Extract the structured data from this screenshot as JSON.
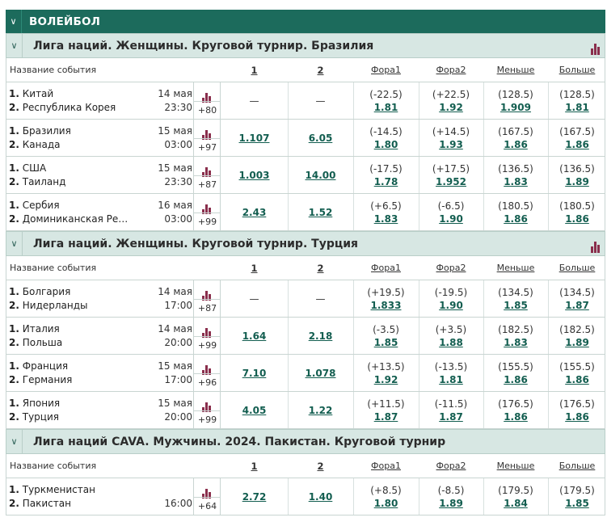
{
  "sport_title": "ВОЛЕЙБОЛ",
  "columns": {
    "event": "Название события",
    "c1": "1",
    "c2": "2",
    "fora1": "Фора1",
    "fora2": "Фора2",
    "less": "Меньше",
    "more": "Больше"
  },
  "leagues": [
    {
      "title": "Лига наций. Женщины. Круговой турнир. Бразилия",
      "stats": true,
      "events": [
        {
          "team1": "Китай",
          "team2": "Республика Корея",
          "date": "14 мая",
          "time": "23:30",
          "more": "+80",
          "o1": "—",
          "o2": "—",
          "f1p": "(-22.5)",
          "f1o": "1.81",
          "f2p": "(+22.5)",
          "f2o": "1.92",
          "lp": "(128.5)",
          "lo": "1.909",
          "mp": "(128.5)",
          "mo": "1.81"
        },
        {
          "team1": "Бразилия",
          "team2": "Канада",
          "date": "15 мая",
          "time": "03:00",
          "more": "+97",
          "o1": "1.107",
          "o2": "6.05",
          "f1p": "(-14.5)",
          "f1o": "1.80",
          "f2p": "(+14.5)",
          "f2o": "1.93",
          "lp": "(167.5)",
          "lo": "1.86",
          "mp": "(167.5)",
          "mo": "1.86"
        },
        {
          "team1": "США",
          "team2": "Таиланд",
          "date": "15 мая",
          "time": "23:30",
          "more": "+87",
          "o1": "1.003",
          "o2": "14.00",
          "f1p": "(-17.5)",
          "f1o": "1.78",
          "f2p": "(+17.5)",
          "f2o": "1.952",
          "lp": "(136.5)",
          "lo": "1.83",
          "mp": "(136.5)",
          "mo": "1.89"
        },
        {
          "team1": "Сербия",
          "team2": "Доминиканская Ре…",
          "date": "16 мая",
          "time": "03:00",
          "more": "+99",
          "o1": "2.43",
          "o2": "1.52",
          "f1p": "(+6.5)",
          "f1o": "1.83",
          "f2p": "(-6.5)",
          "f2o": "1.90",
          "lp": "(180.5)",
          "lo": "1.86",
          "mp": "(180.5)",
          "mo": "1.86"
        }
      ]
    },
    {
      "title": "Лига наций. Женщины. Круговой турнир. Турция",
      "stats": true,
      "events": [
        {
          "team1": "Болгария",
          "team2": "Нидерланды",
          "date": "14 мая",
          "time": "17:00",
          "more": "+87",
          "o1": "—",
          "o2": "—",
          "f1p": "(+19.5)",
          "f1o": "1.833",
          "f2p": "(-19.5)",
          "f2o": "1.90",
          "lp": "(134.5)",
          "lo": "1.85",
          "mp": "(134.5)",
          "mo": "1.87"
        },
        {
          "team1": "Италия",
          "team2": "Польша",
          "date": "14 мая",
          "time": "20:00",
          "more": "+99",
          "o1": "1.64",
          "o2": "2.18",
          "f1p": "(-3.5)",
          "f1o": "1.85",
          "f2p": "(+3.5)",
          "f2o": "1.88",
          "lp": "(182.5)",
          "lo": "1.83",
          "mp": "(182.5)",
          "mo": "1.89"
        },
        {
          "team1": "Франция",
          "team2": "Германия",
          "date": "15 мая",
          "time": "17:00",
          "more": "+96",
          "o1": "7.10",
          "o2": "1.078",
          "f1p": "(+13.5)",
          "f1o": "1.92",
          "f2p": "(-13.5)",
          "f2o": "1.81",
          "lp": "(155.5)",
          "lo": "1.86",
          "mp": "(155.5)",
          "mo": "1.86"
        },
        {
          "team1": "Япония",
          "team2": "Турция",
          "date": "15 мая",
          "time": "20:00",
          "more": "+99",
          "o1": "4.05",
          "o2": "1.22",
          "f1p": "(+11.5)",
          "f1o": "1.87",
          "f2p": "(-11.5)",
          "f2o": "1.87",
          "lp": "(176.5)",
          "lo": "1.86",
          "mp": "(176.5)",
          "mo": "1.86"
        }
      ]
    },
    {
      "title": "Лига наций CAVA. Мужчины. 2024. Пакистан. Круговой турнир",
      "stats": false,
      "events": [
        {
          "team1": "Туркменистан",
          "team2": "Пакистан",
          "date": "",
          "time": "16:00",
          "more": "+64",
          "o1": "2.72",
          "o2": "1.40",
          "f1p": "(+8.5)",
          "f1o": "1.80",
          "f2p": "(-8.5)",
          "f2o": "1.89",
          "lp": "(179.5)",
          "lo": "1.84",
          "mp": "(179.5)",
          "mo": "1.85"
        }
      ]
    }
  ],
  "colors": {
    "header": "#1c6b5c",
    "league_bg": "#d7e7e3",
    "odds": "#135e50",
    "stats_icon": "#8a2e4c"
  }
}
